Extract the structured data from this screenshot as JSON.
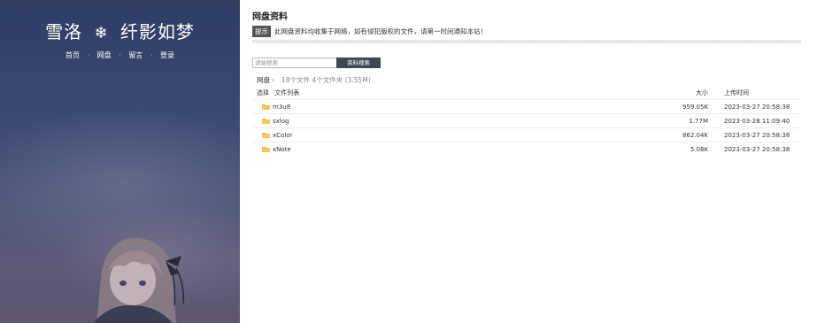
{
  "site": {
    "title_left": "雪洛",
    "title_right": "纤影如梦",
    "icon": "snowflake-icon"
  },
  "nav": {
    "items": [
      {
        "label": "首页"
      },
      {
        "label": "网盘"
      },
      {
        "label": "留言"
      },
      {
        "label": "登录"
      }
    ]
  },
  "main": {
    "title": "网盘资料",
    "notice": {
      "tag": "提示",
      "text": "此网盘资料均收集于网络，如有侵犯版权的文件，请第一时间通知本站！"
    }
  },
  "search": {
    "placeholder": "请输搜索",
    "button_label": "资料搜索"
  },
  "breadcrumb": {
    "root": "网盘",
    "separator": "›",
    "summary": "18个文件 4个文件夹 (3.55M)"
  },
  "table": {
    "headers": {
      "select": "选择",
      "name": "文件列表",
      "size": "大小",
      "time": "上传时间"
    },
    "rows": [
      {
        "name": "m3u8",
        "size": "959.05K",
        "time": "2023-03-27 20:58:38",
        "icon": "folder-icon"
      },
      {
        "name": "sxlog",
        "size": "1.77M",
        "time": "2023-03-28 11:09:40",
        "icon": "folder-icon"
      },
      {
        "name": "xColor",
        "size": "862.04K",
        "time": "2023-03-27 20:58:38",
        "icon": "folder-icon"
      },
      {
        "name": "xNote",
        "size": "5.08K",
        "time": "2023-03-27 20:58:38",
        "icon": "folder-icon"
      }
    ]
  },
  "colors": {
    "sidebar_top": "#2f3d63",
    "sidebar_bottom": "#5e5670",
    "button_bg": "#3e4556",
    "folder": "#e8b84a"
  }
}
